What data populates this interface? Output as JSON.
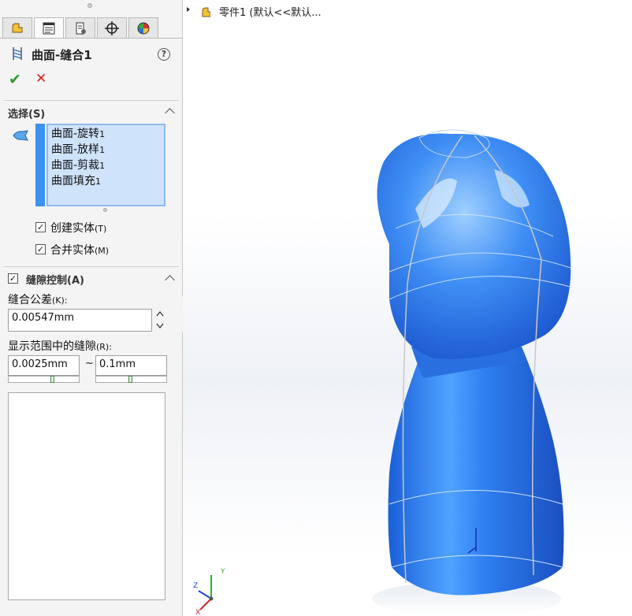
{
  "feature": {
    "title": "曲面-缝合1",
    "help": "?",
    "ok": "✔",
    "cancel": "✕"
  },
  "selection": {
    "header": "选择(S)",
    "items": [
      {
        "name": "曲面-旋转",
        "num": "1"
      },
      {
        "name": "曲面-放样",
        "num": "1"
      },
      {
        "name": "曲面-剪裁",
        "num": "1"
      },
      {
        "name": "曲面填充",
        "num": "1"
      }
    ],
    "create_solid": {
      "label": "创建实体",
      "key": "(T)",
      "checked": true
    },
    "merge_entities": {
      "label": "合并实体",
      "key": "(M)",
      "checked": true
    }
  },
  "gap_control": {
    "header": "缝隙控制(A)",
    "checked": true,
    "tolerance_label": "缝合公差",
    "tolerance_key": "(K):",
    "tolerance_value": "0.00547mm",
    "range_label": "显示范围中的缝隙",
    "range_key": "(R):",
    "range_min": "0.0025mm",
    "range_sep": "~",
    "range_max": "0.1mm"
  },
  "tree": {
    "label": "零件1 (默认<<默认..."
  },
  "triad": {
    "x": "X",
    "y": "Y",
    "z": "Z"
  },
  "colors": {
    "selection_bar": "#3b93f0",
    "selection_bg": "#cfe3fb",
    "model": "#2f7ff0",
    "ok": "#2f9d2f",
    "cancel": "#dd2222"
  }
}
